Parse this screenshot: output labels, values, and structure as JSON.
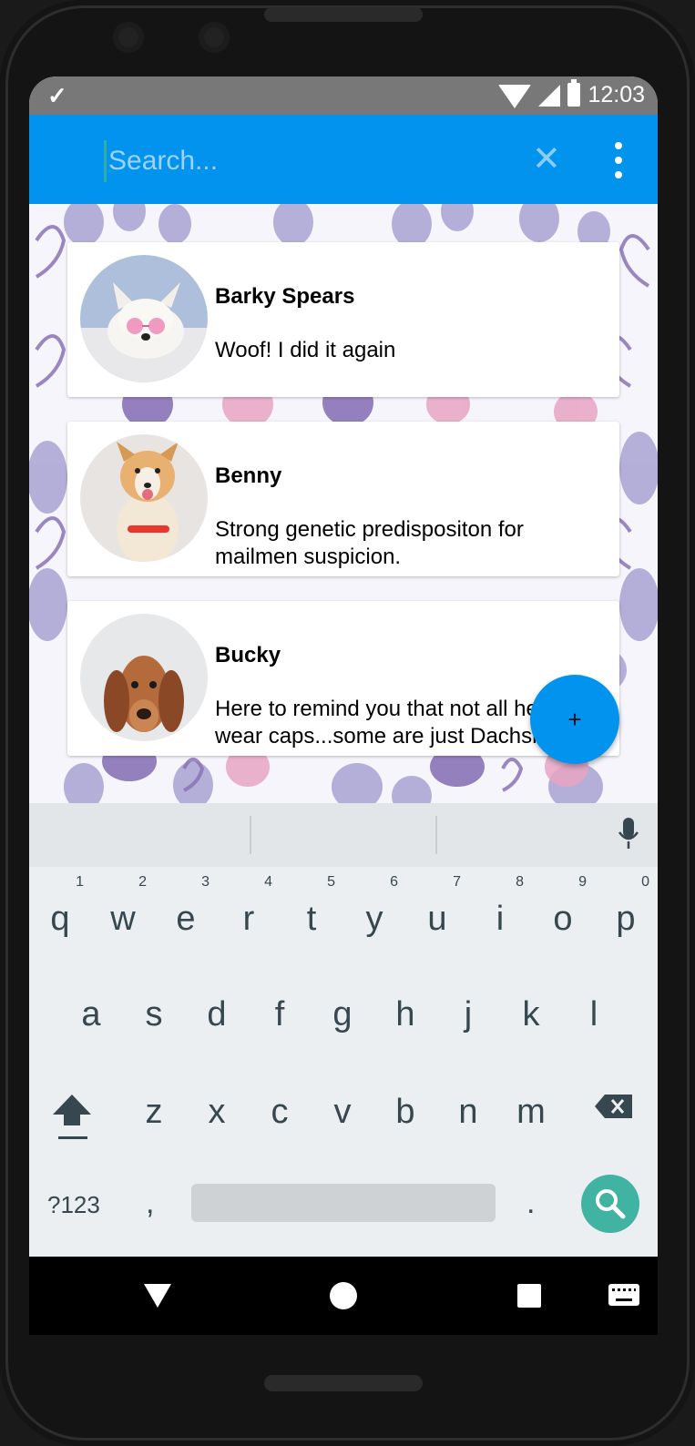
{
  "status_bar": {
    "time": "12:03"
  },
  "search": {
    "placeholder": "Search..."
  },
  "dogs": [
    {
      "name": "Barky Spears",
      "description": "Woof! I did it again"
    },
    {
      "name": "Benny",
      "description": "Strong genetic predispositon for mailmen suspicion."
    },
    {
      "name": "Bucky",
      "description": "Here to remind you that not all heroes wear caps...some are just Dachshunds"
    }
  ],
  "fab": {
    "label": "+"
  },
  "keyboard": {
    "row1": [
      {
        "num": "1",
        "ch": "q"
      },
      {
        "num": "2",
        "ch": "w"
      },
      {
        "num": "3",
        "ch": "e"
      },
      {
        "num": "4",
        "ch": "r"
      },
      {
        "num": "5",
        "ch": "t"
      },
      {
        "num": "6",
        "ch": "y"
      },
      {
        "num": "7",
        "ch": "u"
      },
      {
        "num": "8",
        "ch": "i"
      },
      {
        "num": "9",
        "ch": "o"
      },
      {
        "num": "0",
        "ch": "p"
      }
    ],
    "row2": [
      "a",
      "s",
      "d",
      "f",
      "g",
      "h",
      "j",
      "k",
      "l"
    ],
    "row3": [
      "z",
      "x",
      "c",
      "v",
      "b",
      "n",
      "m"
    ],
    "symbols": "?123",
    "comma": ",",
    "period": "."
  },
  "colors": {
    "primary": "#0293ee",
    "accent": "#41b3a3",
    "status_bar": "#787878",
    "keyboard_bg": "#eceff1"
  }
}
